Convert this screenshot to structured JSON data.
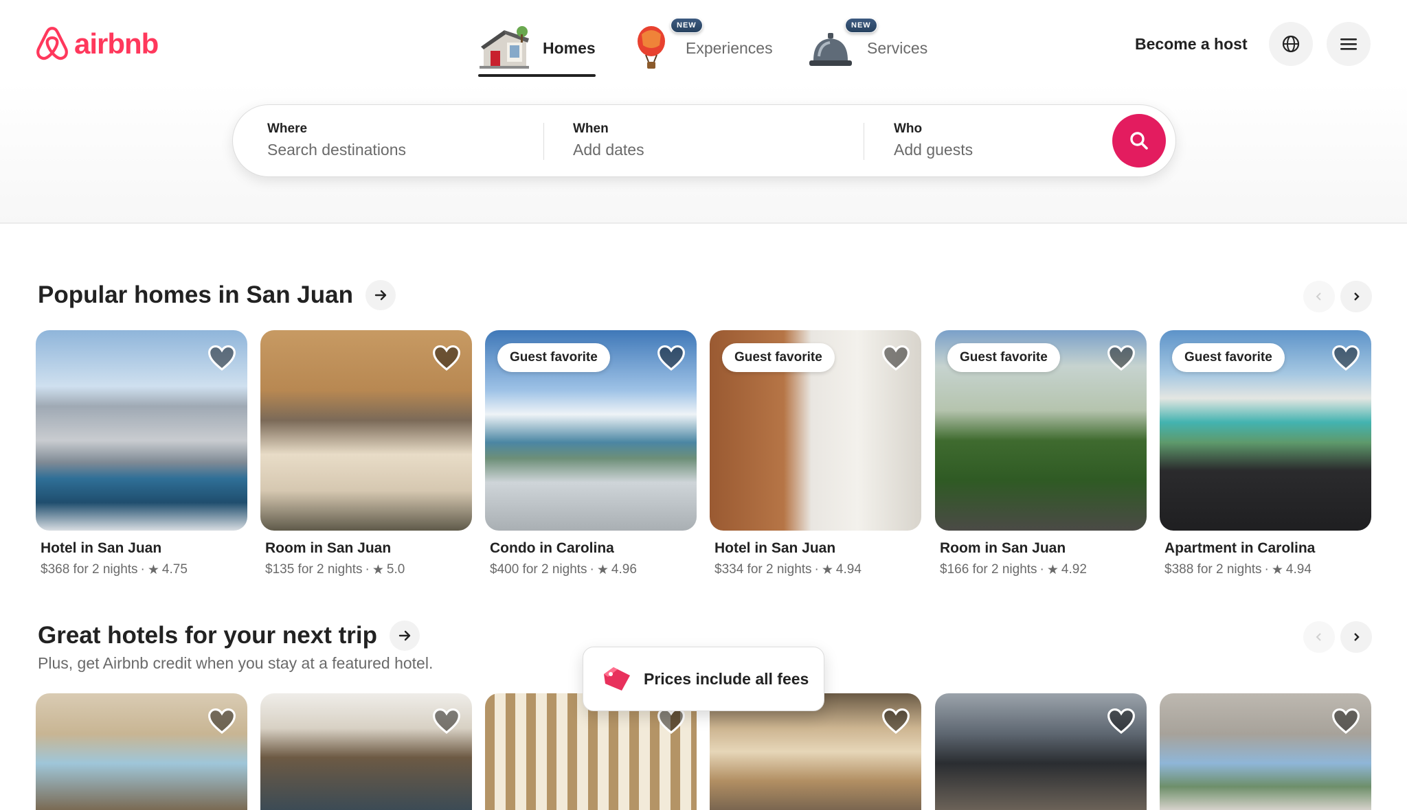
{
  "brand": {
    "name": "airbnb",
    "color": "#ff385c"
  },
  "nav": {
    "tabs": [
      {
        "label": "Homes",
        "icon": "house-icon",
        "active": true,
        "badge": ""
      },
      {
        "label": "Experiences",
        "icon": "hot-air-balloon-icon",
        "active": false,
        "badge": "NEW"
      },
      {
        "label": "Services",
        "icon": "service-bell-icon",
        "active": false,
        "badge": "NEW"
      }
    ],
    "host_link": "Become a host",
    "globe_icon": "globe-icon",
    "menu_icon": "menu-icon"
  },
  "search": {
    "where_label": "Where",
    "where_placeholder": "Search destinations",
    "when_label": "When",
    "when_placeholder": "Add dates",
    "who_label": "Who",
    "who_placeholder": "Add guests",
    "button_icon": "search-icon",
    "button_color": "#e31c5f"
  },
  "sections": [
    {
      "title": "Popular homes in San Juan",
      "listings": [
        {
          "title": "Hotel in San Juan",
          "price": "$368 for 2 nights",
          "rating": "4.75",
          "badge": ""
        },
        {
          "title": "Room in San Juan",
          "price": "$135 for 2 nights",
          "rating": "5.0",
          "badge": ""
        },
        {
          "title": "Condo in Carolina",
          "price": "$400 for 2 nights",
          "rating": "4.96",
          "badge": "Guest favorite"
        },
        {
          "title": "Hotel in San Juan",
          "price": "$334 for 2 nights",
          "rating": "4.94",
          "badge": "Guest favorite"
        },
        {
          "title": "Room in San Juan",
          "price": "$166 for 2 nights",
          "rating": "4.92",
          "badge": "Guest favorite"
        },
        {
          "title": "Apartment in Carolina",
          "price": "$388 for 2 nights",
          "rating": "4.94",
          "badge": "Guest favorite"
        }
      ]
    },
    {
      "title": "Great hotels for your next trip",
      "subtitle": "Plus, get Airbnb credit when you stay at a featured hotel."
    }
  ],
  "toast": {
    "text": "Prices include all fees",
    "icon": "price-tag-icon"
  },
  "rating_separator": "·",
  "star_glyph": "★"
}
